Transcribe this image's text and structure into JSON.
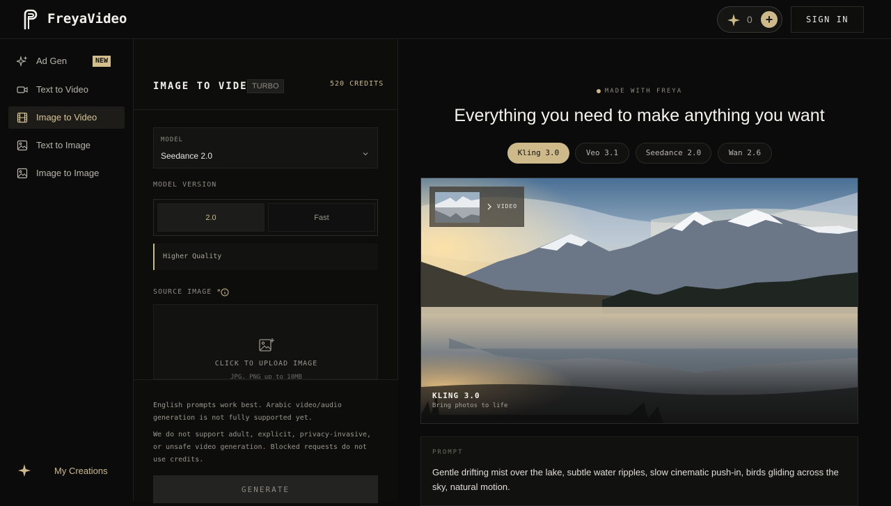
{
  "header": {
    "brand": "FreyaVideo",
    "credit_count": "0",
    "add_symbol": "+",
    "signin_label": "SIGN IN"
  },
  "sidebar": {
    "items": [
      {
        "label": "Ad Gen",
        "icon": "sparkles-icon",
        "badge": "NEW"
      },
      {
        "label": "Text to Video",
        "icon": "video-camera-icon"
      },
      {
        "label": "Image to Video",
        "icon": "film-icon",
        "active": true
      },
      {
        "label": "Text to Image",
        "icon": "image-icon"
      },
      {
        "label": "Image to Image",
        "icon": "image-icon"
      }
    ],
    "my_creations": "My Creations"
  },
  "form": {
    "title": "IMAGE TO VIDEO",
    "mode_badge": "TURBO",
    "credits": "520 CREDITS",
    "model_label": "MODEL",
    "model_value": "Seedance 2.0",
    "version_label": "MODEL VERSION",
    "versions": [
      "2.0",
      "Fast"
    ],
    "version_note": "Higher Quality",
    "source_label": "SOURCE IMAGE",
    "required_mark": "*",
    "upload_label": "CLICK TO UPLOAD IMAGE",
    "upload_sub": "JPG, PNG up to 10MB",
    "note1": "English prompts work best. Arabic video/audio generation is not fully supported yet.",
    "note2": "We do not support adult, explicit, privacy-invasive, or unsafe video generation. Blocked requests do not use credits.",
    "generate_label": "GENERATE"
  },
  "showcase": {
    "made_with": "MADE WITH FREYA",
    "headline": "Everything you need to make anything you want",
    "model_tabs": [
      "Kling 3.0",
      "Veo 3.1",
      "Seedance 2.0",
      "Wan 2.6"
    ],
    "active_tab": 0,
    "chip_label": "VIDEO",
    "hero_title": "KLING 3.0",
    "hero_subtitle": "Bring photos to life",
    "prompt_label": "PROMPT",
    "prompt_text": "Gentle drifting mist over the lake, subtle water ripples, slow cinematic push-in, birds gliding across the sky, natural motion."
  },
  "colors": {
    "accent": "#cdb98a",
    "background": "#0b0b0b",
    "panel": "#0d0d0c"
  }
}
